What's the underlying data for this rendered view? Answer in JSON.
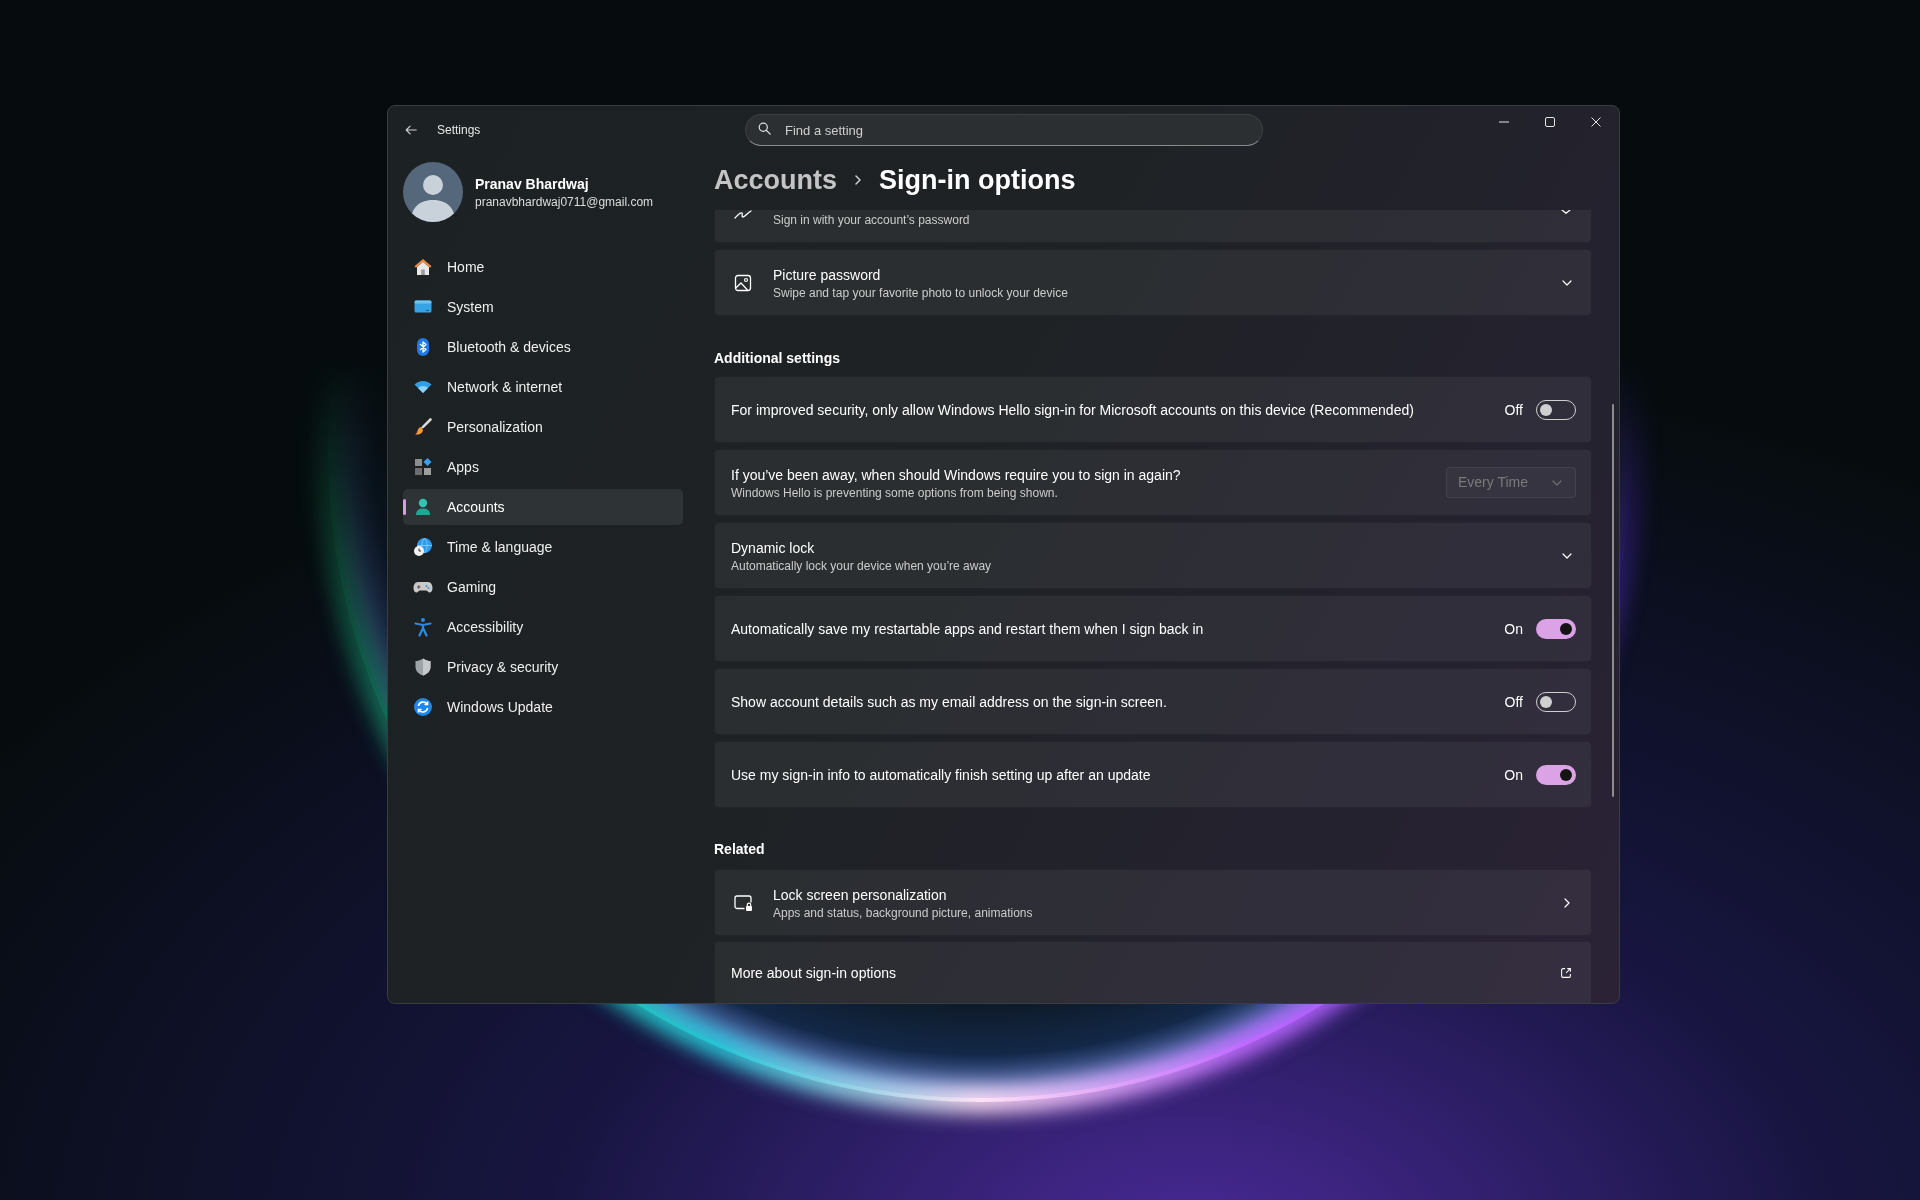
{
  "window": {
    "title": "Settings"
  },
  "search": {
    "placeholder": "Find a setting"
  },
  "profile": {
    "name": "Pranav Bhardwaj",
    "email": "pranavbhardwaj0711@gmail.com"
  },
  "sidebar": {
    "items": [
      {
        "label": "Home",
        "selected": false
      },
      {
        "label": "System",
        "selected": false
      },
      {
        "label": "Bluetooth & devices",
        "selected": false
      },
      {
        "label": "Network & internet",
        "selected": false
      },
      {
        "label": "Personalization",
        "selected": false
      },
      {
        "label": "Apps",
        "selected": false
      },
      {
        "label": "Accounts",
        "selected": true
      },
      {
        "label": "Time & language",
        "selected": false
      },
      {
        "label": "Gaming",
        "selected": false
      },
      {
        "label": "Accessibility",
        "selected": false
      },
      {
        "label": "Privacy & security",
        "selected": false
      },
      {
        "label": "Windows Update",
        "selected": false
      }
    ]
  },
  "breadcrumb": [
    "Accounts",
    "Sign-in options"
  ],
  "top_cards": [
    {
      "kind": "clipped",
      "description": "Sign in with your account’s password"
    },
    {
      "kind": "expander",
      "title": "Picture password",
      "description": "Swipe and tap your favorite photo to unlock your device",
      "expanded": false
    }
  ],
  "additional_settings": {
    "heading": "Additional settings",
    "cards": [
      {
        "kind": "toggle",
        "title": "For improved security, only allow Windows Hello sign-in for Microsoft accounts on this device (Recommended)",
        "state_label": "Off",
        "on": false
      },
      {
        "kind": "dropdown",
        "title": "If you’ve been away, when should Windows require you to sign in again?",
        "description": "Windows Hello is preventing some options from being shown.",
        "dropdown": {
          "value": "Every Time",
          "disabled": true
        }
      },
      {
        "kind": "expander",
        "title": "Dynamic lock",
        "description": "Automatically lock your device when you’re away",
        "expanded": false
      },
      {
        "kind": "toggle",
        "title": "Automatically save my restartable apps and restart them when I sign back in",
        "state_label": "On",
        "on": true
      },
      {
        "kind": "toggle",
        "title": "Show account details such as my email address on the sign-in screen.",
        "state_label": "Off",
        "on": false
      },
      {
        "kind": "toggle",
        "title": "Use my sign-in info to automatically finish setting up after an update",
        "state_label": "On",
        "on": true
      }
    ]
  },
  "related": {
    "heading": "Related",
    "cards": [
      {
        "kind": "link",
        "title": "Lock screen personalization",
        "description": "Apps and status, background picture, animations"
      },
      {
        "kind": "external",
        "title": "More about sign-in options"
      }
    ]
  }
}
